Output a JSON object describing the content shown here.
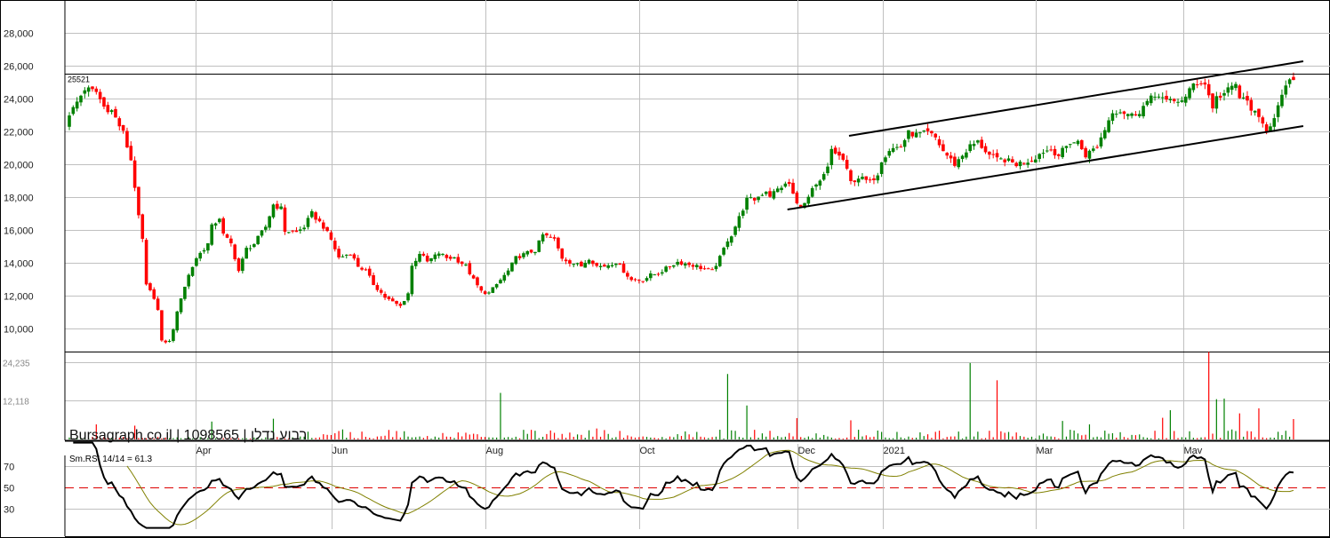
{
  "chart_data": {
    "type": "candlestick",
    "watermark": "Bursagraph.co.il | 1098565 | רבוע נדלן",
    "colors": {
      "up": "#008000",
      "down": "#ff0000",
      "grid": "#c0c0c0",
      "rsi": "#000000",
      "rsi_ma": "#808000",
      "rsi_mid": "#dd0000"
    },
    "price_axis": {
      "ticks": [
        10000,
        12000,
        14000,
        16000,
        18000,
        20000,
        22000,
        24000,
        26000,
        28000
      ],
      "tick_labels": [
        "10,000",
        "12,000",
        "14,000",
        "16,000",
        "18,000",
        "20,000",
        "22,000",
        "24,000",
        "26,000",
        "28,000"
      ],
      "range": [
        8600,
        30000
      ]
    },
    "reference_line": {
      "value": 25521,
      "label": "25521"
    },
    "channel_lines": [
      {
        "from": [
          203,
          21730
        ],
        "to": [
          321,
          26270
        ]
      },
      {
        "from": [
          187,
          17244
        ],
        "to": [
          321,
          22325
        ]
      }
    ],
    "x_ticks": [
      {
        "bar": 33.3,
        "label": "Apr"
      },
      {
        "bar": 68.6,
        "label": "Jun"
      },
      {
        "bar": 108.5,
        "label": "Aug"
      },
      {
        "bar": 148.5,
        "label": "Oct"
      },
      {
        "bar": 189.6,
        "label": "Dec"
      },
      {
        "bar": 211.8,
        "label": "2021"
      },
      {
        "bar": 251.5,
        "label": "Mar"
      },
      {
        "bar": 289.8,
        "label": "Mav"
      }
    ],
    "close_path": [
      [
        0,
        22970
      ],
      [
        4,
        24600
      ],
      [
        7,
        24400
      ],
      [
        9,
        23500
      ],
      [
        11,
        23250
      ],
      [
        14,
        21900
      ],
      [
        16,
        20270
      ],
      [
        17,
        18650
      ],
      [
        18,
        16750
      ],
      [
        19,
        15400
      ],
      [
        20,
        12600
      ],
      [
        22,
        11900
      ],
      [
        23,
        11100
      ],
      [
        24,
        9200
      ],
      [
        26,
        9200
      ],
      [
        27,
        10000
      ],
      [
        29,
        11900
      ],
      [
        31,
        13250
      ],
      [
        33,
        14300
      ],
      [
        36,
        15150
      ],
      [
        37,
        16200
      ],
      [
        39,
        16750
      ],
      [
        40,
        15700
      ],
      [
        42,
        15150
      ],
      [
        44,
        13500
      ],
      [
        46,
        14850
      ],
      [
        48,
        15150
      ],
      [
        51,
        16200
      ],
      [
        53,
        17550
      ],
      [
        55,
        17300
      ],
      [
        56,
        15950
      ],
      [
        59,
        15850
      ],
      [
        61,
        16200
      ],
      [
        63,
        17000
      ],
      [
        66,
        16200
      ],
      [
        68,
        15400
      ],
      [
        70,
        14300
      ],
      [
        73,
        14600
      ],
      [
        75,
        13800
      ],
      [
        77,
        13500
      ],
      [
        79,
        12700
      ],
      [
        82,
        11900
      ],
      [
        84,
        11600
      ],
      [
        86,
        11350
      ],
      [
        88,
        12150
      ],
      [
        89,
        13800
      ],
      [
        91,
        14600
      ],
      [
        93,
        14050
      ],
      [
        96,
        14600
      ],
      [
        98,
        14300
      ],
      [
        100,
        14300
      ],
      [
        103,
        13800
      ],
      [
        105,
        12950
      ],
      [
        107,
        12250
      ],
      [
        109,
        12150
      ],
      [
        112,
        12950
      ],
      [
        114,
        13500
      ],
      [
        116,
        14300
      ],
      [
        119,
        14600
      ],
      [
        121,
        14750
      ],
      [
        123,
        15700
      ],
      [
        126,
        15400
      ],
      [
        128,
        14300
      ],
      [
        130,
        14050
      ],
      [
        133,
        13800
      ],
      [
        135,
        14300
      ],
      [
        137,
        13800
      ],
      [
        139,
        13800
      ],
      [
        142,
        14050
      ],
      [
        144,
        13500
      ],
      [
        146,
        12950
      ],
      [
        149,
        12950
      ],
      [
        151,
        13250
      ],
      [
        153,
        13350
      ],
      [
        156,
        13800
      ],
      [
        158,
        14050
      ],
      [
        160,
        13950
      ],
      [
        163,
        13800
      ],
      [
        165,
        13600
      ],
      [
        167,
        13500
      ],
      [
        169,
        14300
      ],
      [
        171,
        15400
      ],
      [
        172,
        15700
      ],
      [
        174,
        16750
      ],
      [
        176,
        17850
      ],
      [
        178,
        17850
      ],
      [
        181,
        18400
      ],
      [
        182,
        18100
      ],
      [
        185,
        18650
      ],
      [
        187,
        18800
      ],
      [
        189,
        17550
      ],
      [
        191,
        17550
      ],
      [
        193,
        18400
      ],
      [
        195,
        18900
      ],
      [
        197,
        19750
      ],
      [
        198,
        20900
      ],
      [
        201,
        20270
      ],
      [
        203,
        18900
      ],
      [
        205,
        19200
      ],
      [
        208,
        18900
      ],
      [
        210,
        19450
      ],
      [
        211,
        20270
      ],
      [
        213,
        20900
      ],
      [
        216,
        21100
      ],
      [
        218,
        21900
      ],
      [
        220,
        21800
      ],
      [
        223,
        21900
      ],
      [
        225,
        21600
      ],
      [
        227,
        20800
      ],
      [
        230,
        20000
      ],
      [
        232,
        20550
      ],
      [
        234,
        21100
      ],
      [
        236,
        21350
      ],
      [
        239,
        20550
      ],
      [
        241,
        20270
      ],
      [
        243,
        20270
      ],
      [
        246,
        20000
      ],
      [
        248,
        20150
      ],
      [
        250,
        20270
      ],
      [
        253,
        20800
      ],
      [
        255,
        20900
      ],
      [
        257,
        20550
      ],
      [
        260,
        21350
      ],
      [
        262,
        21350
      ],
      [
        264,
        20550
      ],
      [
        267,
        21100
      ],
      [
        269,
        22150
      ],
      [
        271,
        23250
      ],
      [
        273,
        23250
      ],
      [
        276,
        22970
      ],
      [
        278,
        23250
      ],
      [
        280,
        23800
      ],
      [
        283,
        24300
      ],
      [
        285,
        23800
      ],
      [
        287,
        23800
      ],
      [
        290,
        24050
      ],
      [
        292,
        24870
      ],
      [
        294,
        25030
      ],
      [
        295,
        24870
      ],
      [
        297,
        23500
      ],
      [
        298,
        24050
      ],
      [
        300,
        24300
      ],
      [
        303,
        24870
      ],
      [
        304,
        24050
      ],
      [
        306,
        23800
      ],
      [
        309,
        22700
      ],
      [
        311,
        22150
      ],
      [
        312,
        22430
      ],
      [
        314,
        23500
      ],
      [
        316,
        24600
      ],
      [
        317,
        25240
      ],
      [
        318,
        25130
      ]
    ],
    "volume_axis": {
      "ticks": [
        12118,
        24235
      ],
      "tick_labels": [
        "12,118",
        "24,235"
      ]
    },
    "volume_spikes": [
      [
        7,
        4500
      ],
      [
        17,
        4100
      ],
      [
        37,
        5400
      ],
      [
        53,
        6300
      ],
      [
        70,
        2400
      ],
      [
        112,
        14500
      ],
      [
        137,
        3200
      ],
      [
        171,
        20500
      ],
      [
        176,
        10500
      ],
      [
        189,
        6500
      ],
      [
        203,
        5800
      ],
      [
        234,
        24000
      ],
      [
        241,
        18500
      ],
      [
        258,
        5600
      ],
      [
        265,
        4500
      ],
      [
        284,
        6600
      ],
      [
        286,
        9000
      ],
      [
        298,
        12500
      ],
      [
        300,
        12700
      ],
      [
        296,
        27500
      ],
      [
        304,
        8000
      ],
      [
        309,
        9600
      ],
      [
        318,
        6200
      ]
    ],
    "rsi": {
      "label": "Sm.RSI 14/14 = 61.3",
      "period": 14,
      "ma_period": 14,
      "last_value": 61.3,
      "ticks": [
        30,
        50,
        70
      ],
      "tick_labels": [
        "30",
        "50",
        "70"
      ]
    }
  }
}
